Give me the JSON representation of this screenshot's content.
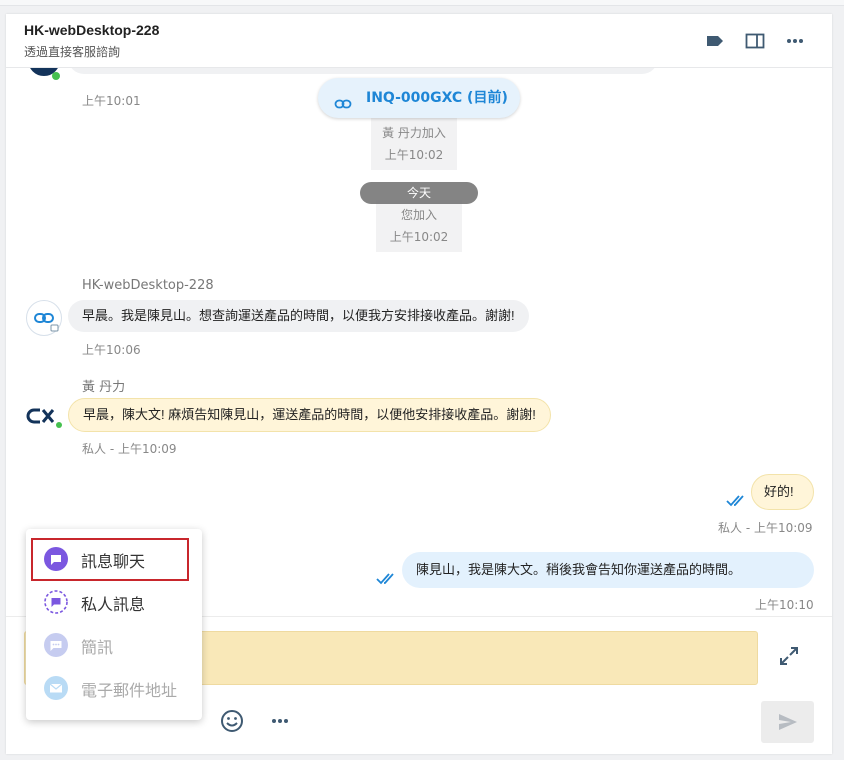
{
  "header": {
    "title": "HK-webDesktop-228",
    "subtitle": "透過直接客服諮詢",
    "icons": [
      "tag-icon",
      "split-view-icon",
      "more-horizontal-icon"
    ]
  },
  "chat": {
    "prev_message_time": "上午10:01",
    "inquiry_pill": "INQ-000GXC (目前)",
    "today_pill": "今天",
    "system_events": [
      {
        "text": "黃 丹力加入",
        "time": "上午10:02"
      },
      {
        "text": "您加入",
        "time": "上午10:02"
      }
    ],
    "messages": [
      {
        "sender": "HK-webDesktop-228",
        "text": "早晨。我是陳見山。想查詢運送產品的時間，以便我方安排接收產品。謝謝!",
        "meta": "上午10:06",
        "avatar": "link-icon"
      },
      {
        "sender": "黃 丹力",
        "text": "早晨，陳大文! 麻煩告知陳見山，運送產品的時間，以便他安排接收產品。謝謝!",
        "meta": "私人 - 上午10:09",
        "avatar": "cx-logo"
      },
      {
        "sender": "",
        "text": "好的!",
        "meta": "私人 - 上午10:09"
      },
      {
        "sender": "",
        "text": "陳見山，我是陳大文。稍後我會告知你運送產品的時間。",
        "meta": "上午10:10"
      }
    ]
  },
  "channel_menu": {
    "items": [
      {
        "label": "訊息聊天",
        "icon": "chat-icon",
        "selected": true,
        "enabled": true
      },
      {
        "label": "私人訊息",
        "icon": "private-message-icon",
        "selected": false,
        "enabled": true
      },
      {
        "label": "簡訊",
        "icon": "sms-icon",
        "selected": false,
        "enabled": false
      },
      {
        "label": "電子郵件地址",
        "icon": "email-icon",
        "selected": false,
        "enabled": false
      }
    ]
  },
  "composer": {
    "value": "",
    "icons": [
      "expand-icon",
      "emoji-icon",
      "more-horizontal-icon",
      "send-icon"
    ]
  },
  "colors": {
    "accent_blue": "#1e86d6",
    "private_bubble": "#fff5d9",
    "outgoing_bubble": "#e3f1fd",
    "menu_highlight": "#c8262c",
    "chat_icon_purple": "#7b57e0"
  }
}
